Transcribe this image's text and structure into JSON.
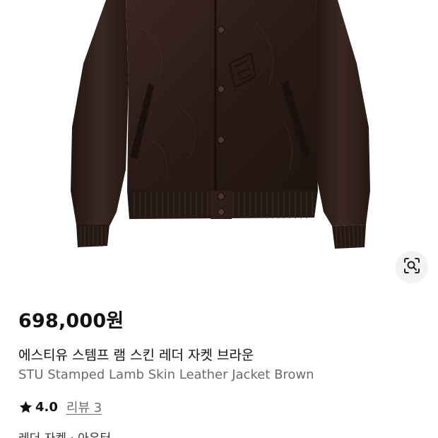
{
  "product": {
    "price": "698,000원",
    "title_ko": "에스티유 스템프 램 스킨 레더 자켓 브라운",
    "title_en": "STU Stamped Lamb Skin Leather Jacket Brown",
    "rating": "4.0",
    "review_link": "리뷰 3",
    "category": "레더 자켓 · 아우터"
  },
  "icons": {
    "lens": "image-search-icon",
    "star": "star-icon"
  },
  "colors": {
    "leather": "#2e1d18",
    "price_text": "#111111",
    "secondary_text": "#6b6b6b",
    "lens_bg": "#f2f2f2"
  }
}
